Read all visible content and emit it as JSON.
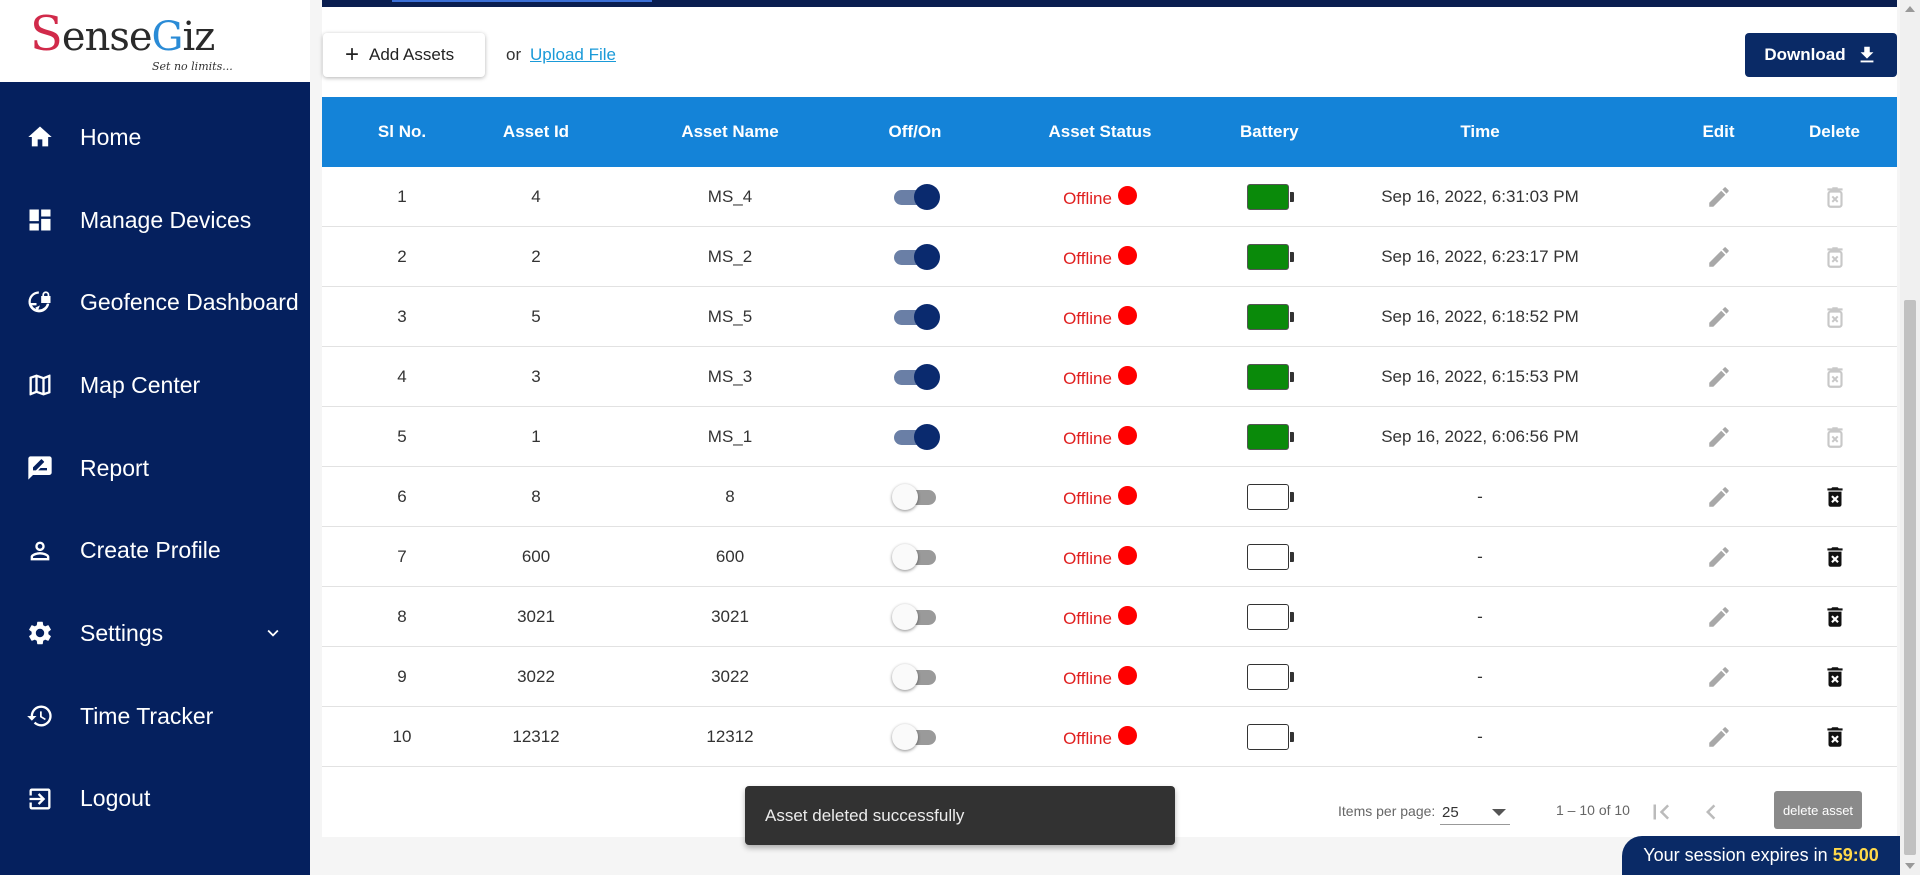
{
  "brand": {
    "name_s": "S",
    "name_ense": "ense",
    "name_g": "G",
    "name_iz": "iz",
    "tagline": "Set no limits..."
  },
  "sidebar": {
    "items": [
      {
        "label": "Home",
        "icon": "home-icon"
      },
      {
        "label": "Manage Devices",
        "icon": "dashboard-icon"
      },
      {
        "label": "Geofence Dashboard",
        "icon": "globe-lock-icon"
      },
      {
        "label": "Map Center",
        "icon": "map-icon"
      },
      {
        "label": "Report",
        "icon": "report-icon"
      },
      {
        "label": "Create Profile",
        "icon": "person-icon"
      },
      {
        "label": "Settings",
        "icon": "gear-icon"
      },
      {
        "label": "Time Tracker",
        "icon": "history-icon"
      },
      {
        "label": "Logout",
        "icon": "logout-icon"
      }
    ]
  },
  "actions": {
    "add_label": "Add Assets",
    "or_text": "or",
    "upload_label": "Upload File",
    "download_label": "Download"
  },
  "table": {
    "headers": [
      "Sl No.",
      "Asset Id",
      "Asset Name",
      "Off/On",
      "Asset Status",
      "Battery",
      "Time",
      "Edit",
      "Delete"
    ],
    "rows": [
      {
        "sl": "1",
        "id": "4",
        "name": "MS_4",
        "on": true,
        "status": "Offline",
        "battery": "full",
        "time": "Sep 16, 2022, 6:31:03 PM"
      },
      {
        "sl": "2",
        "id": "2",
        "name": "MS_2",
        "on": true,
        "status": "Offline",
        "battery": "full",
        "time": "Sep 16, 2022, 6:23:17 PM"
      },
      {
        "sl": "3",
        "id": "5",
        "name": "MS_5",
        "on": true,
        "status": "Offline",
        "battery": "full",
        "time": "Sep 16, 2022, 6:18:52 PM"
      },
      {
        "sl": "4",
        "id": "3",
        "name": "MS_3",
        "on": true,
        "status": "Offline",
        "battery": "full",
        "time": "Sep 16, 2022, 6:15:53 PM"
      },
      {
        "sl": "5",
        "id": "1",
        "name": "MS_1",
        "on": true,
        "status": "Offline",
        "battery": "full",
        "time": "Sep 16, 2022, 6:06:56 PM"
      },
      {
        "sl": "6",
        "id": "8",
        "name": "8",
        "on": false,
        "status": "Offline",
        "battery": "empty",
        "time": "-"
      },
      {
        "sl": "7",
        "id": "600",
        "name": "600",
        "on": false,
        "status": "Offline",
        "battery": "empty",
        "time": "-"
      },
      {
        "sl": "8",
        "id": "3021",
        "name": "3021",
        "on": false,
        "status": "Offline",
        "battery": "empty",
        "time": "-"
      },
      {
        "sl": "9",
        "id": "3022",
        "name": "3022",
        "on": false,
        "status": "Offline",
        "battery": "empty",
        "time": "-"
      },
      {
        "sl": "10",
        "id": "12312",
        "name": "12312",
        "on": false,
        "status": "Offline",
        "battery": "empty",
        "time": "-"
      }
    ]
  },
  "paginator": {
    "items_per_page_label": "Items per page:",
    "items_per_page": "25",
    "range": "1 – 10 of 10",
    "delete_asset_label": "delete asset"
  },
  "snackbar": {
    "message": "Asset deleted successfully"
  },
  "session": {
    "label": "Your session expires in",
    "time": "59:00"
  },
  "colors": {
    "sidebar": "#05205e",
    "header": "#1483d8",
    "battery_full": "#0a8a0a",
    "status_offline": "#e02020",
    "primary_button": "#0a2a66"
  }
}
